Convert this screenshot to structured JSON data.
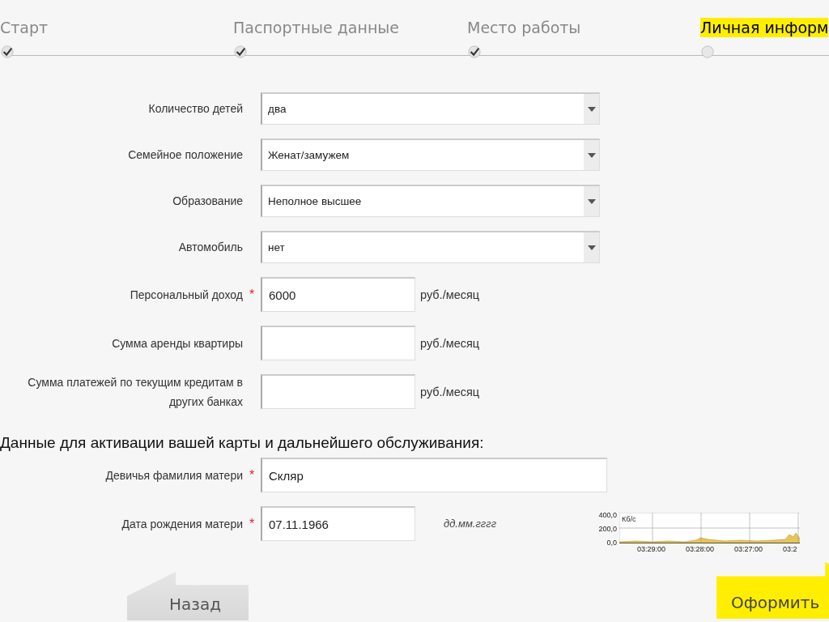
{
  "steps": [
    {
      "label": "Старт",
      "done": true,
      "selected": false
    },
    {
      "label": "Паспортные данные",
      "done": true,
      "selected": false
    },
    {
      "label": "Место работы",
      "done": true,
      "selected": false
    },
    {
      "label": "Личная информ",
      "done": false,
      "selected": true
    }
  ],
  "fields": [
    {
      "kind": "select",
      "label": "Количество детей",
      "value": "два"
    },
    {
      "kind": "select",
      "label": "Семейное положение",
      "value": "Женат/замужем"
    },
    {
      "kind": "select",
      "label": "Образование",
      "value": "Неполное высшее"
    },
    {
      "kind": "select",
      "label": "Автомобиль",
      "value": "нет"
    },
    {
      "kind": "text",
      "label": "Персональный доход",
      "required_mark": "*",
      "value": "6000",
      "suffix": "руб./месяц"
    },
    {
      "kind": "text",
      "label": "Сумма аренды квартиры",
      "suffix": "руб./месяц"
    },
    {
      "kind": "text",
      "label": "Сумма платежей по текущим кредитам в других банках",
      "suffix": "руб./месяц"
    }
  ],
  "section_title": "Данные для активации вашей карты и дальнейшего обслуживания:",
  "activation_fields": [
    {
      "kind": "wide",
      "label": "Девичья фамилия матери",
      "required_mark": "*",
      "value": "Скляр"
    },
    {
      "kind": "date",
      "label": "Дата рождения матери",
      "required_mark": "*",
      "value": "07.11.1966",
      "hint": "дд.мм.гггг"
    }
  ],
  "traffic_graph": {
    "unit": "Кб/с",
    "y_labels": [
      "400,0",
      "200,0",
      "0,0"
    ],
    "x_labels": [
      "03:29:00",
      "03:28:00",
      "03:27:00",
      "03:2"
    ]
  },
  "buttons": [
    {
      "kind": "back",
      "label": "Назад"
    },
    {
      "kind": "submit",
      "label": "Оформить"
    }
  ]
}
